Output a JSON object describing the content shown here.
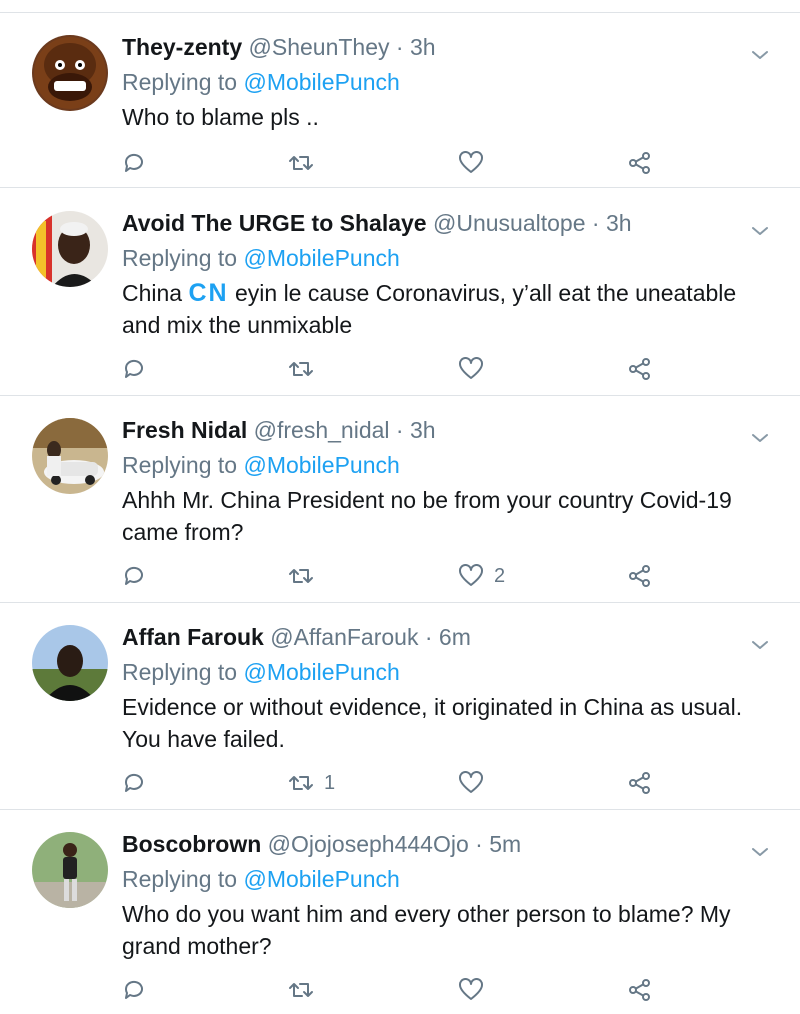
{
  "ui": {
    "reply_prefix": "Replying to",
    "colors": {
      "text": "#14171a",
      "muted": "#657786",
      "link": "#1da1f2",
      "divider": "#dfe3e7"
    },
    "icons": [
      "reply-icon",
      "retweet-icon",
      "like-icon",
      "share-icon",
      "chevron-down-icon"
    ]
  },
  "tweets": [
    {
      "name": "They-zenty",
      "handle": "@SheunThey",
      "separator": "·",
      "time": "3h",
      "mention": "@MobilePunch",
      "text": "Who to blame pls ..",
      "retweets": "",
      "likes": ""
    },
    {
      "name": "Avoid The URGE to Shalaye",
      "handle": "@Unusualtope",
      "separator": "·",
      "time": "3h",
      "mention": "@MobilePunch",
      "text_before_flag": "China ",
      "flag": "CN",
      "text": " eyin le cause Coronavirus, y’all eat the uneatable and mix the unmixable",
      "retweets": "",
      "likes": ""
    },
    {
      "name": "Fresh Nidal",
      "handle": "@fresh_nidal",
      "separator": "·",
      "time": "3h",
      "mention": "@MobilePunch",
      "text": "Ahhh Mr. China President no be from your country Covid-19 came from?",
      "retweets": "",
      "likes": "2"
    },
    {
      "name": "Affan Farouk",
      "handle": "@AffanFarouk",
      "separator": "·",
      "time": "6m",
      "mention": "@MobilePunch",
      "text": "Evidence or without evidence, it originated in China as usual. You have failed.",
      "retweets": "1",
      "likes": ""
    },
    {
      "name": "Boscobrown",
      "handle": "@Ojojoseph444Ojo",
      "separator": "·",
      "time": "5m",
      "mention": "@MobilePunch",
      "text": "Who do you want him and every other person to blame? My grand mother?",
      "retweets": "",
      "likes": ""
    }
  ]
}
